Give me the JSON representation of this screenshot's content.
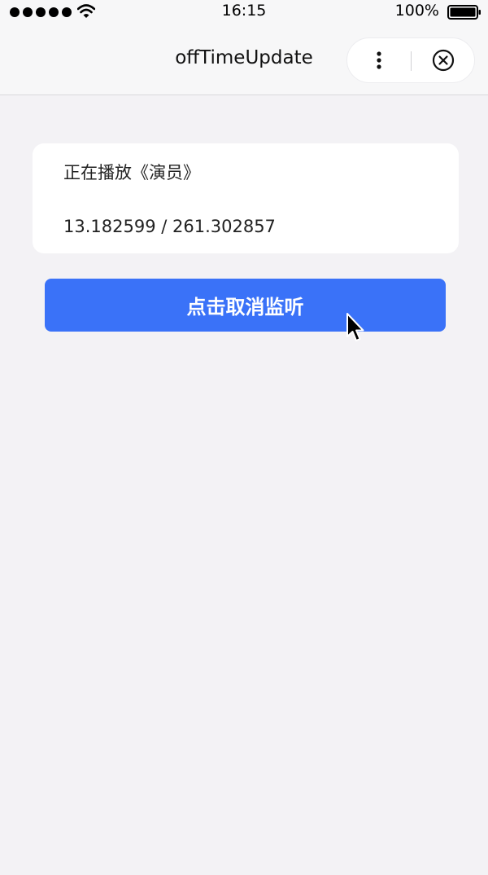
{
  "status_bar": {
    "time": "16:15",
    "battery": "100%"
  },
  "nav": {
    "title": "offTimeUpdate"
  },
  "card": {
    "now_playing": "正在播放《演员》",
    "time": "13.182599 / 261.302857"
  },
  "button": {
    "label": "点击取消监听"
  },
  "colors": {
    "accent": "#3a72f8",
    "background": "#f3f2f5"
  },
  "icons": [
    "signal-dots-icon",
    "wifi-icon",
    "battery-icon",
    "more-icon",
    "close-icon",
    "cursor-icon"
  ]
}
